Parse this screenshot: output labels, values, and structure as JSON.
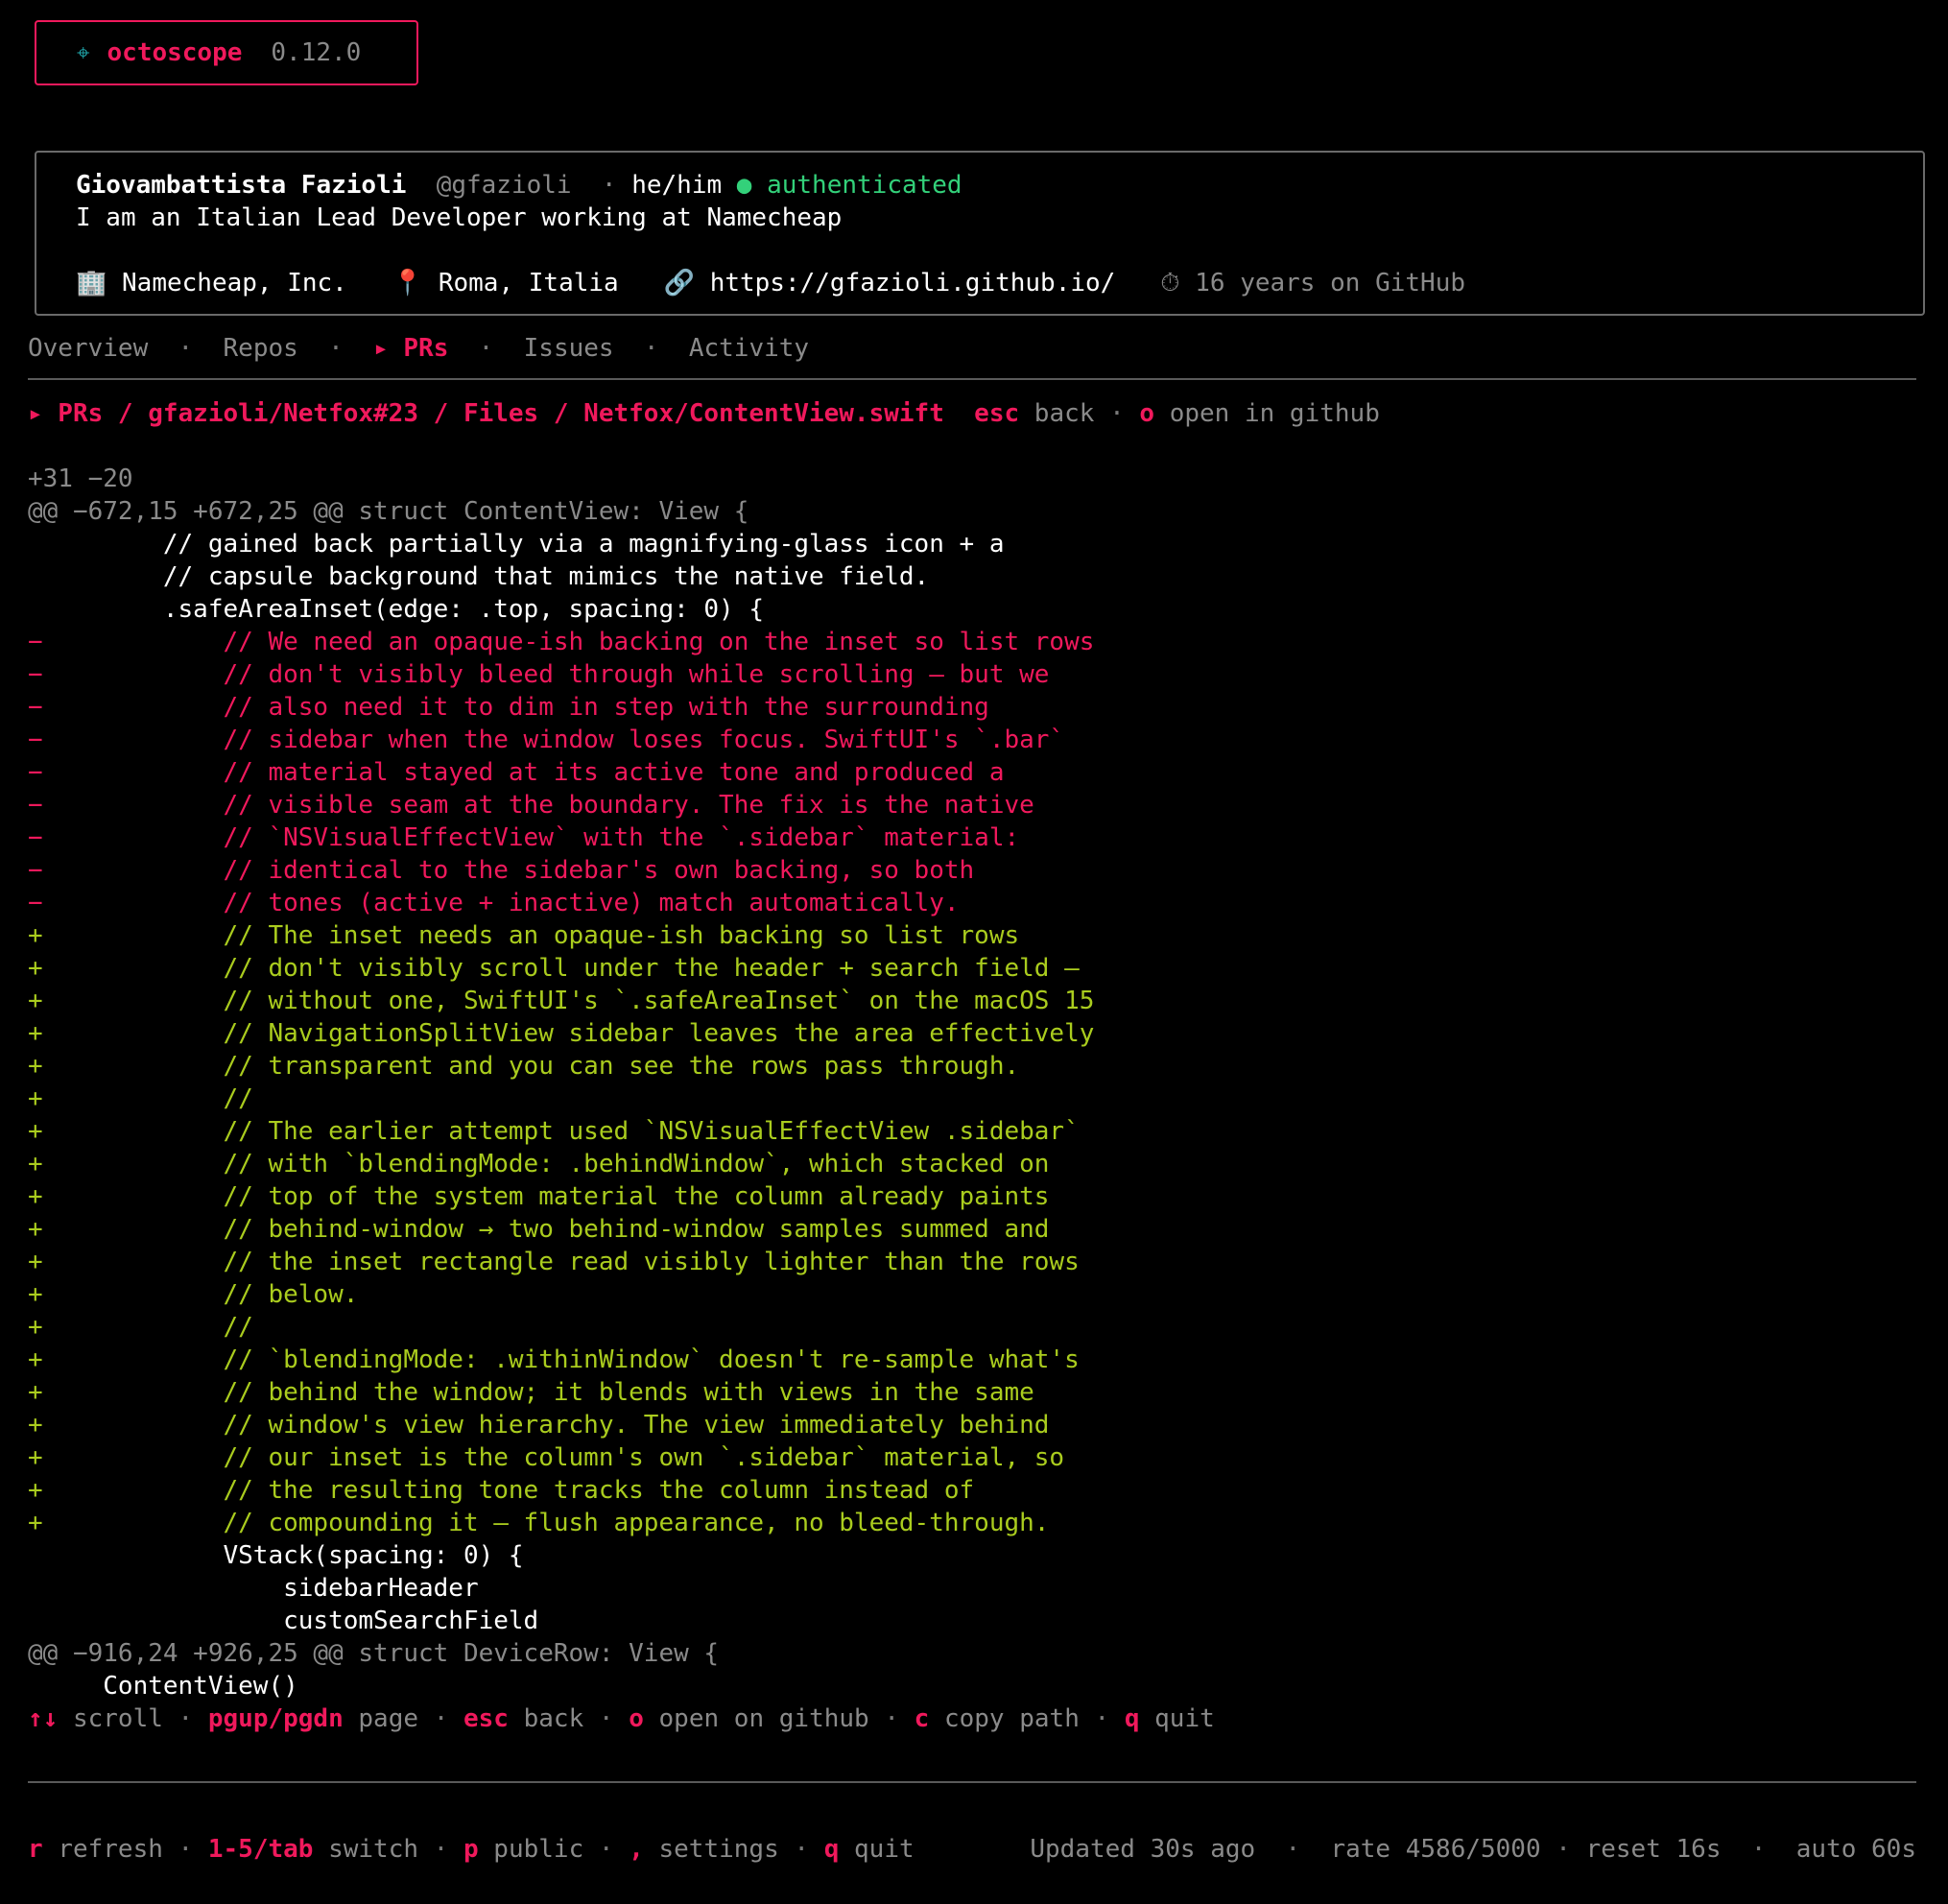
{
  "brand": {
    "icon": "crosshair-icon",
    "name": "octoscope",
    "version": "0.12.0"
  },
  "profile": {
    "name": "Giovambattista Fazioli",
    "handle": "@gfazioli",
    "separator": "·",
    "pronouns": "he/him",
    "status_dot": "●",
    "status": "authenticated",
    "bio": "I am an Italian Lead Developer working at Namecheap",
    "company_icon": "🏢",
    "company": "Namecheap, Inc.",
    "location_icon": "📍",
    "location": "Roma, Italia",
    "link_icon": "🔗",
    "website": "https://gfazioli.github.io/",
    "age_icon": "⏱",
    "age": "16 years on GitHub"
  },
  "tabs": [
    {
      "label": "Overview"
    },
    {
      "label": "Repos"
    },
    {
      "label": "▸ PRs"
    },
    {
      "label": "Issues"
    },
    {
      "label": "Activity"
    }
  ],
  "tab_separator": "·",
  "breadcrumb": {
    "path": "▸ PRs / gfazioli/Netfox#23 / Files / Netfox/ContentView.swift",
    "back_key": "esc",
    "back_label": "back",
    "separator": "·",
    "open_key": "o",
    "open_label": "open in github"
  },
  "diff": {
    "stats": "+31 −20",
    "hunk1": "@@ −672,15 +672,25 @@ struct ContentView: View {",
    "context_top": [
      "         // gained back partially via a magnifying-glass icon + a",
      "         // capsule background that mimics the native field.",
      "         .safeAreaInset(edge: .top, spacing: 0) {"
    ],
    "removed": [
      "−            // We need an opaque-ish backing on the inset so list rows",
      "−            // don't visibly bleed through while scrolling — but we",
      "−            // also need it to dim in step with the surrounding",
      "−            // sidebar when the window loses focus. SwiftUI's `.bar`",
      "−            // material stayed at its active tone and produced a",
      "−            // visible seam at the boundary. The fix is the native",
      "−            // `NSVisualEffectView` with the `.sidebar` material:",
      "−            // identical to the sidebar's own backing, so both",
      "−            // tones (active + inactive) match automatically."
    ],
    "added": [
      "+            // The inset needs an opaque-ish backing so list rows",
      "+            // don't visibly scroll under the header + search field —",
      "+            // without one, SwiftUI's `.safeAreaInset` on the macOS 15",
      "+            // NavigationSplitView sidebar leaves the area effectively",
      "+            // transparent and you can see the rows pass through.",
      "+            //",
      "+            // The earlier attempt used `NSVisualEffectView .sidebar`",
      "+            // with `blendingMode: .behindWindow`, which stacked on",
      "+            // top of the system material the column already paints",
      "+            // behind-window → two behind-window samples summed and",
      "+            // the inset rectangle read visibly lighter than the rows",
      "+            // below.",
      "+            //",
      "+            // `blendingMode: .withinWindow` doesn't re-sample what's",
      "+            // behind the window; it blends with views in the same",
      "+            // window's view hierarchy. The view immediately behind",
      "+            // our inset is the column's own `.sidebar` material, so",
      "+            // the resulting tone tracks the column instead of",
      "+            // compounding it — flush appearance, no bleed-through."
    ],
    "context_bottom": [
      "             VStack(spacing: 0) {",
      "                 sidebarHeader",
      "                 customSearchField"
    ],
    "hunk2": "@@ −916,24 +926,25 @@ struct DeviceRow: View {",
    "context_tail": [
      "     ContentView()"
    ]
  },
  "help": {
    "scroll_key": "↑↓",
    "scroll_label": "scroll",
    "page_key": "pgup/pgdn",
    "page_label": "page",
    "back_key": "esc",
    "back_label": "back",
    "open_key": "o",
    "open_label": "open on github",
    "copy_key": "c",
    "copy_label": "copy path",
    "quit_key": "q",
    "quit_label": "quit",
    "separator": "·"
  },
  "footer": {
    "refresh_key": "r",
    "refresh_label": "refresh",
    "switch_key": "1-5/tab",
    "switch_label": "switch",
    "public_key": "p",
    "public_label": "public",
    "settings_key": ",",
    "settings_label": "settings",
    "quit_key": "q",
    "quit_label": "quit",
    "updated": "Updated 30s ago",
    "rate": "rate 4586/5000",
    "reset": "reset 16s",
    "auto": "auto 60s",
    "separator": "·"
  },
  "colors": {
    "accent": "#f0195c",
    "added": "#aacc1e",
    "muted": "#8a8a8a",
    "authenticated": "#33d17a",
    "brand_icon": "#1fa3a8"
  }
}
